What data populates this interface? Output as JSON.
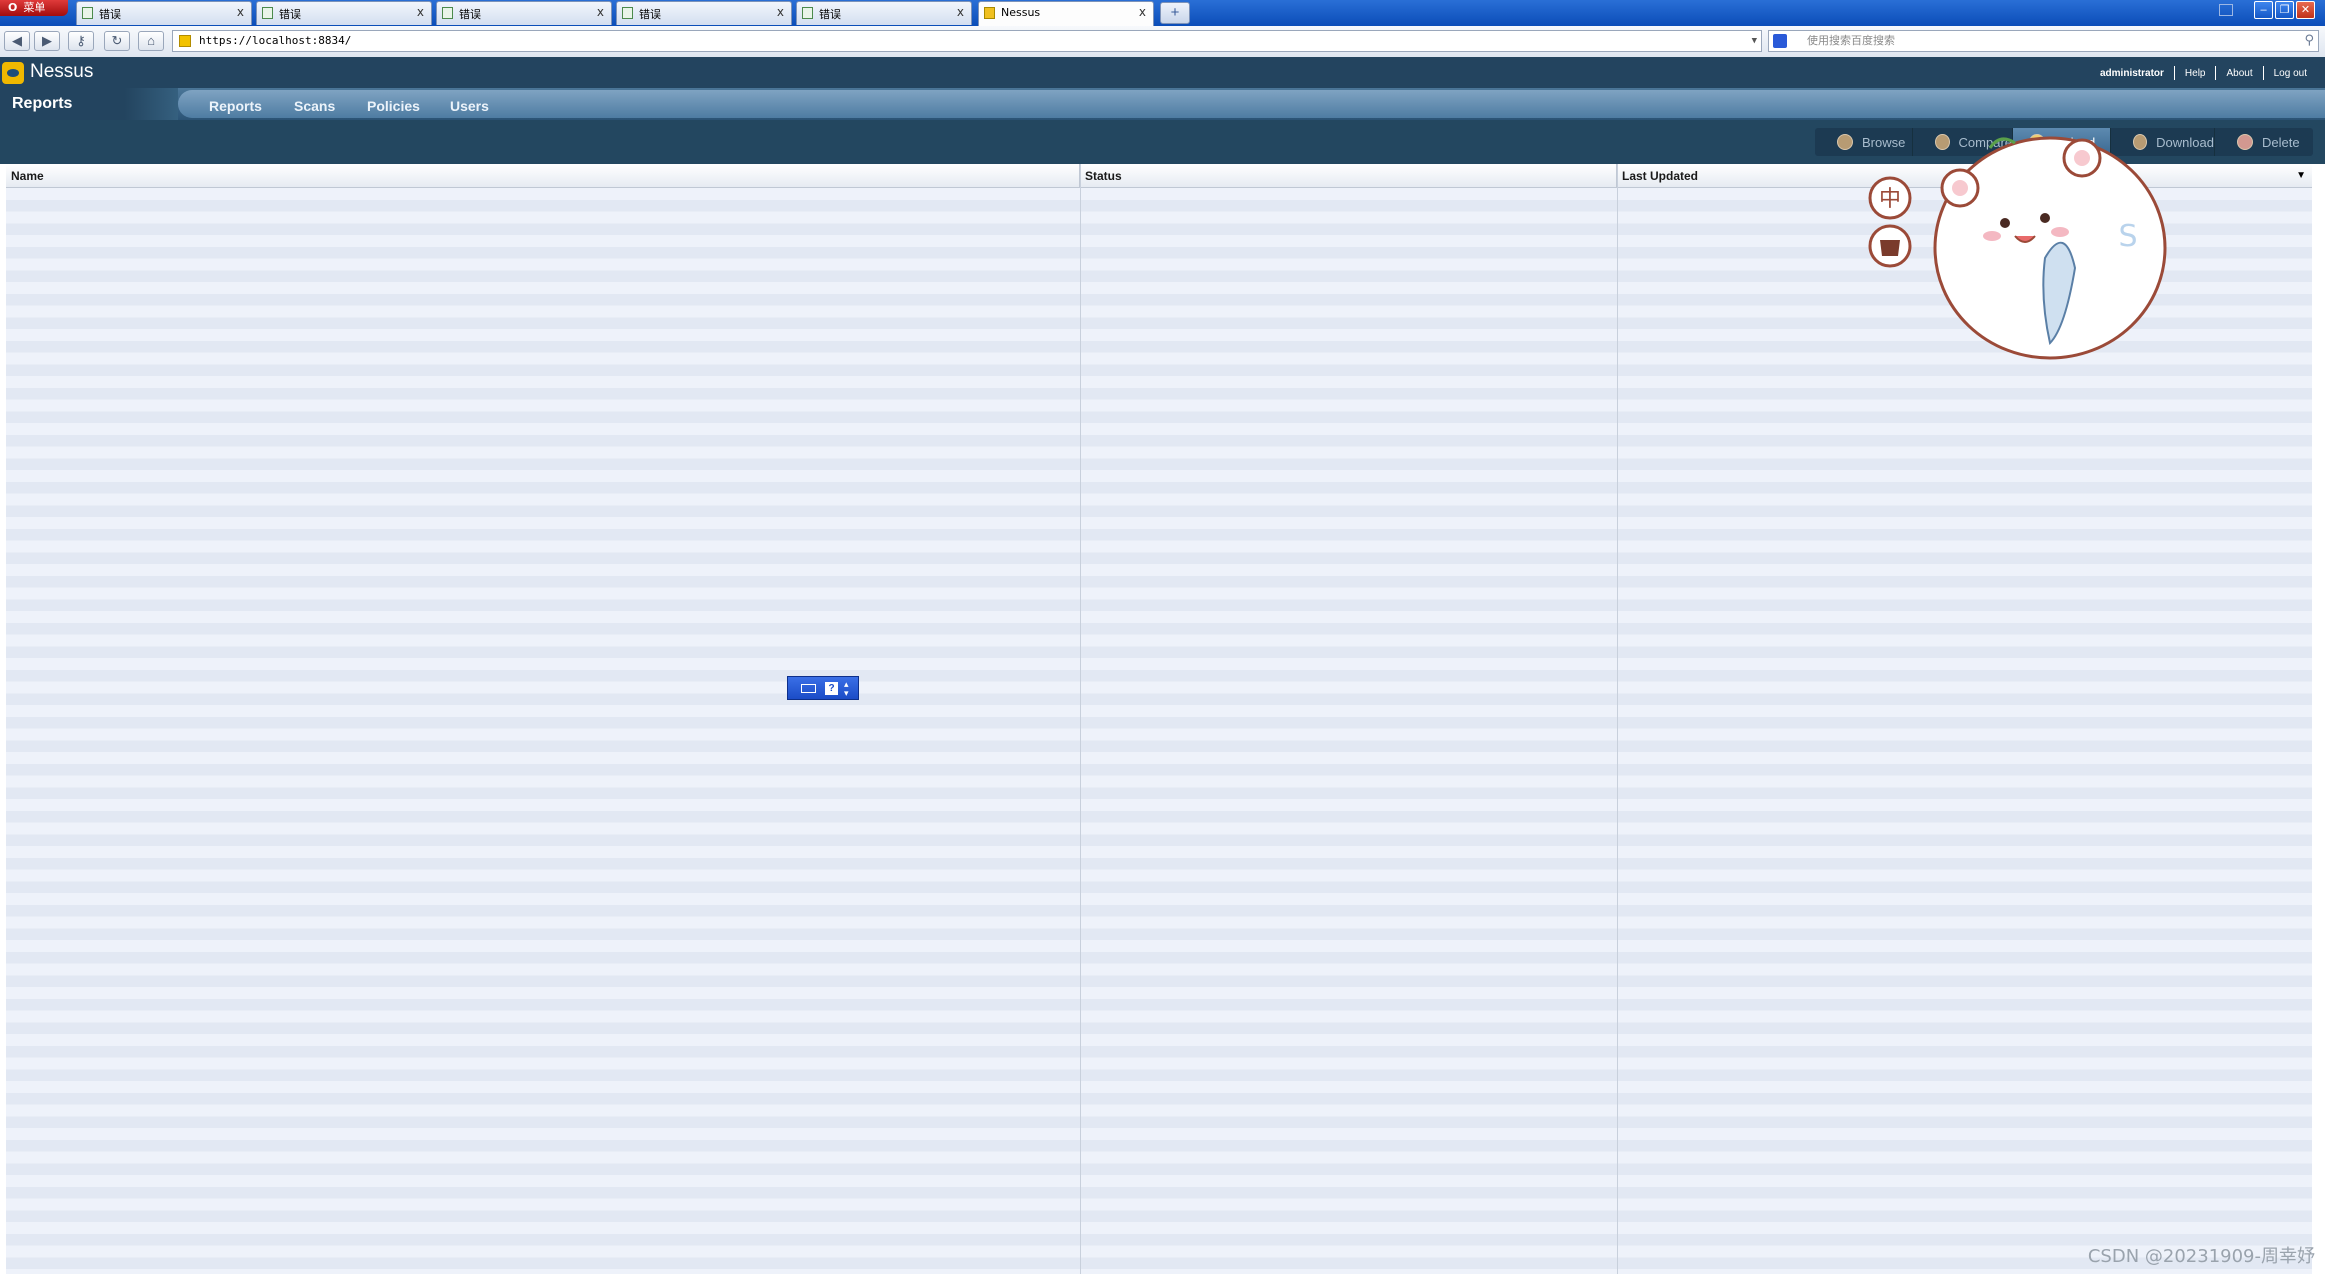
{
  "browser": {
    "menu_label": "菜单",
    "tabs": [
      {
        "label": "错误",
        "active": false
      },
      {
        "label": "错误",
        "active": false
      },
      {
        "label": "错误",
        "active": false
      },
      {
        "label": "错误",
        "active": false
      },
      {
        "label": "错误",
        "active": false
      },
      {
        "label": "Nessus",
        "active": true
      }
    ],
    "tab_close_glyph": "x",
    "address": "https://localhost:8834/",
    "search_placeholder": "使用搜索百度搜索"
  },
  "app": {
    "name": "Nessus",
    "user": "administrator",
    "links": [
      "Help",
      "About",
      "Log out"
    ],
    "section_title": "Reports",
    "nav": [
      "Reports",
      "Scans",
      "Policies",
      "Users"
    ]
  },
  "toolbar": {
    "buttons": [
      {
        "label": "Browse",
        "icon": "browse-icon",
        "active": false
      },
      {
        "label": "Compare",
        "icon": "compare-icon",
        "active": false
      },
      {
        "label": "Upload",
        "icon": "upload-icon",
        "active": true
      },
      {
        "label": "Download",
        "icon": "download-icon",
        "active": false
      },
      {
        "label": "Delete",
        "icon": "delete-icon",
        "active": false
      }
    ]
  },
  "table": {
    "columns": [
      "Name",
      "Status",
      "Last Updated"
    ],
    "sort_glyph": "▼",
    "rows": []
  },
  "overlay": {
    "sticker_chars": [
      "中",
      "S"
    ],
    "watermark": "CSDN @20231909-周幸妤"
  },
  "colors": {
    "header_bg": "#23445f",
    "nav_bg": "#4e7ca2",
    "row_light": "#eef2fa",
    "row_dark": "#e2e8f3"
  }
}
